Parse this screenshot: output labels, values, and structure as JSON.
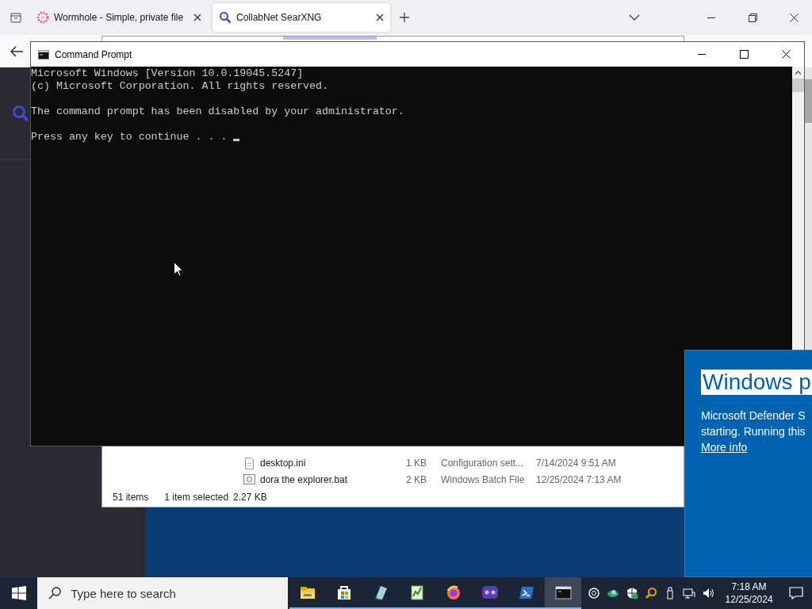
{
  "browser": {
    "tabs": [
      {
        "title": "Wormhole - Simple, private file",
        "selected": false
      },
      {
        "title": "CollabNet SearXNG",
        "selected": true
      }
    ]
  },
  "explorer": {
    "files": [
      {
        "name": "desktop.ini",
        "size": "1 KB",
        "type": "Configuration sett...",
        "modified": "7/14/2024 9:51 AM",
        "kind": "settings"
      },
      {
        "name": "dora the explorer.bat",
        "size": "2 KB",
        "type": "Windows Batch File",
        "modified": "12/25/2024 7:13 AM",
        "kind": "batch"
      }
    ],
    "status": {
      "count": "51 items",
      "selection": "1 item selected",
      "size": "2.27 KB"
    }
  },
  "console": {
    "title": "Command Prompt",
    "blocks": [
      {
        "lines": [
          "Microsoft Windows [Version 10.0.19045.5247]",
          "(c) Microsoft Corporation. All rights reserved."
        ]
      },
      {
        "lines": [
          "The command prompt has been disabled by your administrator."
        ]
      },
      {
        "lines": [
          "Press any key to continue . . ."
        ],
        "cursor": true
      }
    ]
  },
  "smartscreen": {
    "title": "Windows p",
    "title_selected": true,
    "message_lines": [
      "Microsoft Defender S",
      "starting. Running this"
    ],
    "link": "More info"
  },
  "taskbar": {
    "search_placeholder": "Type here to search",
    "apps": [
      {
        "active": false
      },
      {
        "active": false
      },
      {
        "active": false
      },
      {
        "active": false
      },
      {
        "active": false
      },
      {
        "active": false
      },
      {
        "active": false
      },
      {
        "active": true
      }
    ],
    "time": "7:18 AM",
    "date": "12/25/2024"
  }
}
